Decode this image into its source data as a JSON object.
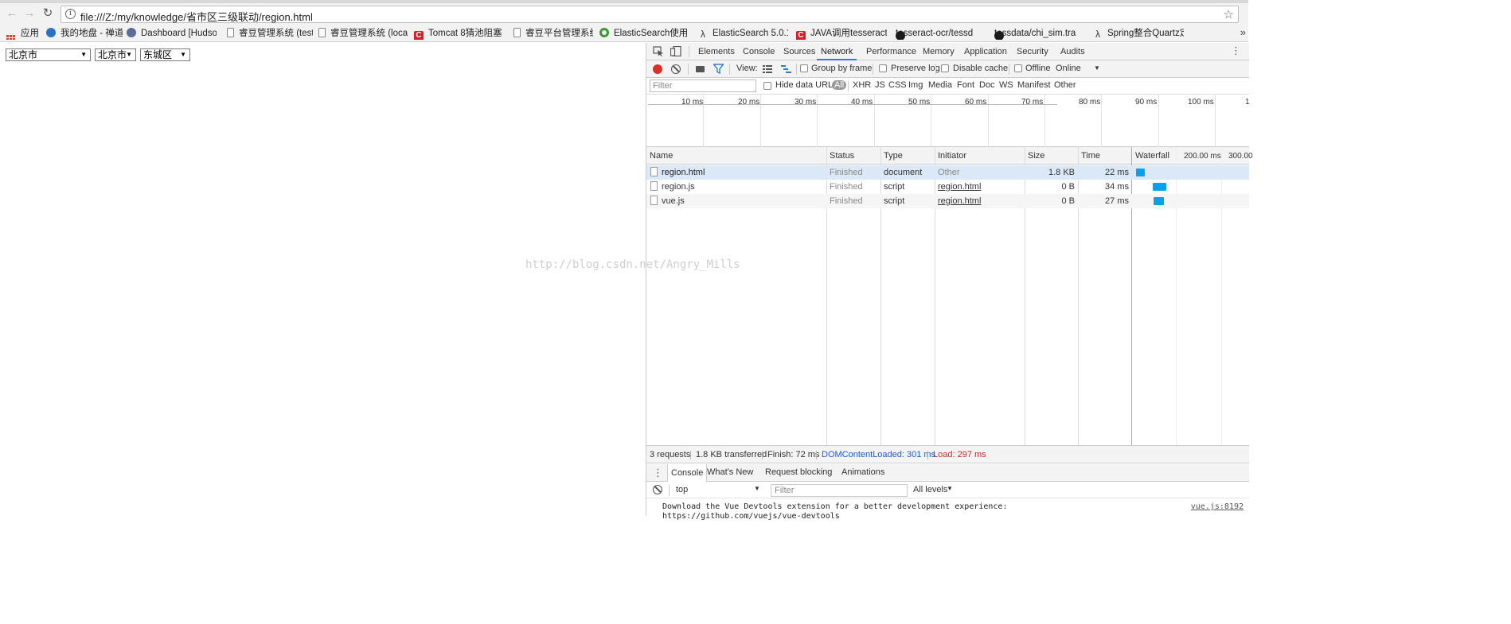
{
  "browser": {
    "url": "file:///Z:/my/knowledge/省市区三级联动/region.html",
    "bookmarks": [
      {
        "label": "应用",
        "icon": "apps-grid-icon"
      },
      {
        "label": "我的地盘 - 禅道",
        "icon": "globe-icon"
      },
      {
        "label": "Dashboard [Hudson",
        "icon": "hudson-icon"
      },
      {
        "label": "睿豆管理系统 (test)",
        "icon": "page-icon"
      },
      {
        "label": "睿豆管理系统 (local)",
        "icon": "page-icon"
      },
      {
        "label": "Tomcat 8猜池阻塞",
        "icon": "csdn-icon"
      },
      {
        "label": "睿豆平台管理系统",
        "icon": "page-icon"
      },
      {
        "label": "ElasticSearch使用 -",
        "icon": "green-c-icon"
      },
      {
        "label": "ElasticSearch 5.0.1 j",
        "icon": "lambda-icon"
      },
      {
        "label": "JAVA调用tesseract",
        "icon": "csdn-icon"
      },
      {
        "label": "tesseract-ocr/tessd",
        "icon": "github-icon"
      },
      {
        "label": "tessdata/chi_sim.tra",
        "icon": "github-icon"
      },
      {
        "label": "Spring整合Quartz定",
        "icon": "lambda-icon"
      }
    ]
  },
  "page": {
    "province": "北京市",
    "city": "北京市",
    "district": "东城区",
    "watermark": "http://blog.csdn.net/Angry_Mills"
  },
  "devtools": {
    "tabs": [
      "Elements",
      "Console",
      "Sources",
      "Network",
      "Performance",
      "Memory",
      "Application",
      "Security",
      "Audits"
    ],
    "active_tab": "Network",
    "toolbar": {
      "view_label": "View:",
      "group_by_frame": "Group by frame",
      "preserve_log": "Preserve log",
      "disable_cache": "Disable cache",
      "offline": "Offline",
      "throttle": "Online"
    },
    "filter_placeholder": "Filter",
    "hide_data_urls": "Hide data URLs",
    "types": [
      "All",
      "XHR",
      "JS",
      "CSS",
      "Img",
      "Media",
      "Font",
      "Doc",
      "WS",
      "Manifest",
      "Other"
    ],
    "timeline_ticks": [
      "10 ms",
      "20 ms",
      "30 ms",
      "40 ms",
      "50 ms",
      "60 ms",
      "70 ms",
      "80 ms",
      "90 ms",
      "100 ms",
      "1"
    ],
    "columns": {
      "name": "Name",
      "status": "Status",
      "type": "Type",
      "initiator": "Initiator",
      "size": "Size",
      "time": "Time",
      "waterfall": "Waterfall",
      "wf_tick1": "200.00 ms",
      "wf_tick2": "300.00"
    },
    "requests": [
      {
        "name": "region.html",
        "status": "Finished",
        "type": "document",
        "initiator": "Other",
        "size": "1.8 KB",
        "time": "22 ms"
      },
      {
        "name": "region.js",
        "status": "Finished",
        "type": "script",
        "initiator": "region.html",
        "size": "0 B",
        "time": "34 ms"
      },
      {
        "name": "vue.js",
        "status": "Finished",
        "type": "script",
        "initiator": "region.html",
        "size": "0 B",
        "time": "27 ms"
      }
    ],
    "summary": {
      "requests": "3 requests",
      "transferred": "1.8 KB transferred",
      "finish": "Finish: 72 ms",
      "dom_loaded": "DOMContentLoaded: 301 ms",
      "load": "Load: 297 ms"
    },
    "drawer_tabs": [
      "Console",
      "What's New",
      "Request blocking",
      "Animations"
    ],
    "console": {
      "context": "top",
      "filter_placeholder": "Filter",
      "levels": "All levels",
      "message": "Download the Vue Devtools extension for a better development experience:",
      "message2": "https://github.com/vuejs/vue-devtools",
      "source": "vue.js:8192"
    },
    "colors": {
      "accent": "#3879d9",
      "record": "#d93025",
      "waterfall": "#0aa1e8",
      "dom_loaded": "#1a5dd8",
      "load": "#d22222"
    }
  }
}
